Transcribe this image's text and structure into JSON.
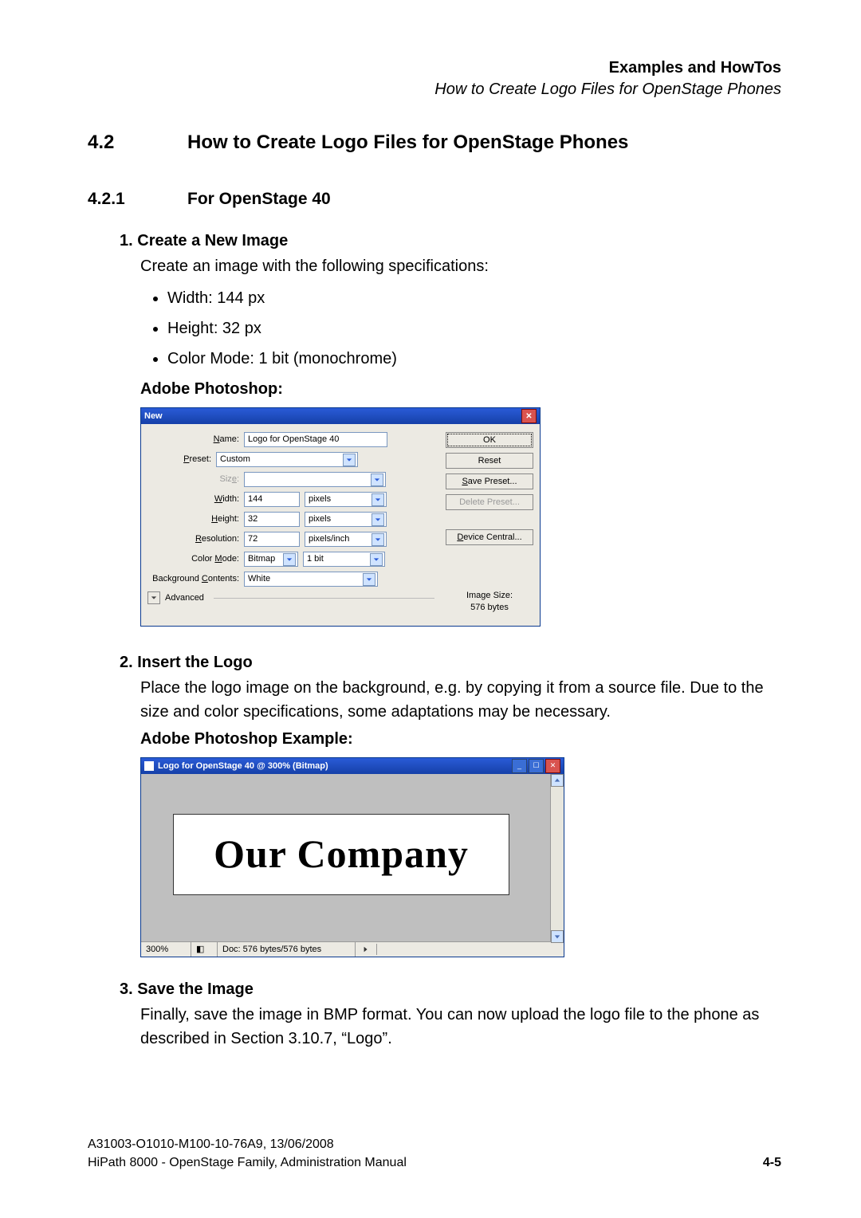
{
  "header": {
    "line1": "Examples and HowTos",
    "line2": "How to Create Logo Files for OpenStage Phones"
  },
  "section": {
    "num": "4.2",
    "title": "How to Create Logo Files for OpenStage Phones"
  },
  "subsection": {
    "num": "4.2.1",
    "title": "For OpenStage 40"
  },
  "step1": {
    "num": "1.",
    "title": "Create a New Image",
    "text": "Create an image with the following specifications:",
    "specs": [
      "Width: 144 px",
      "Height: 32 px",
      "Color Mode: 1 bit (monochrome)"
    ],
    "app_label": "Adobe Photoshop:"
  },
  "ps_dialog": {
    "title": "New",
    "labels": {
      "name": "Name:",
      "preset": "Preset:",
      "size": "Size:",
      "width": "Width:",
      "height": "Height:",
      "resolution": "Resolution:",
      "color_mode": "Color Mode:",
      "bg": "Background Contents:",
      "advanced": "Advanced"
    },
    "values": {
      "name": "Logo for OpenStage 40",
      "preset": "Custom",
      "size": "",
      "width": "144",
      "width_unit": "pixels",
      "height": "32",
      "height_unit": "pixels",
      "resolution": "72",
      "resolution_unit": "pixels/inch",
      "color_mode": "Bitmap",
      "color_depth": "1 bit",
      "bg": "White"
    },
    "buttons": {
      "ok": "OK",
      "reset": "Reset",
      "save_preset": "Save Preset...",
      "delete_preset": "Delete Preset...",
      "device_central": "Device Central..."
    },
    "info": {
      "label": "Image Size:",
      "value": "576 bytes"
    }
  },
  "step2": {
    "num": "2.",
    "title": "Insert the Logo",
    "text": "Place the logo image on the background, e.g. by copying it from a source file. Due to the size and color specifications, some adaptations may be necessary.",
    "app_label": "Adobe Photoshop Example:"
  },
  "ps_window": {
    "title": "Logo for OpenStage 40 @ 300% (Bitmap)",
    "canvas_text": "Our Company",
    "status": {
      "zoom": "300%",
      "doc": "Doc: 576 bytes/576 bytes"
    }
  },
  "step3": {
    "num": "3.",
    "title": "Save the Image",
    "text": "Finally, save the image in BMP format. You can now upload the logo file to the phone as described in Section 3.10.7, “Logo”."
  },
  "footer": {
    "line1": "A31003-O1010-M100-10-76A9, 13/06/2008",
    "line2": "HiPath 8000 - OpenStage Family, Administration Manual",
    "page": "4-5"
  }
}
